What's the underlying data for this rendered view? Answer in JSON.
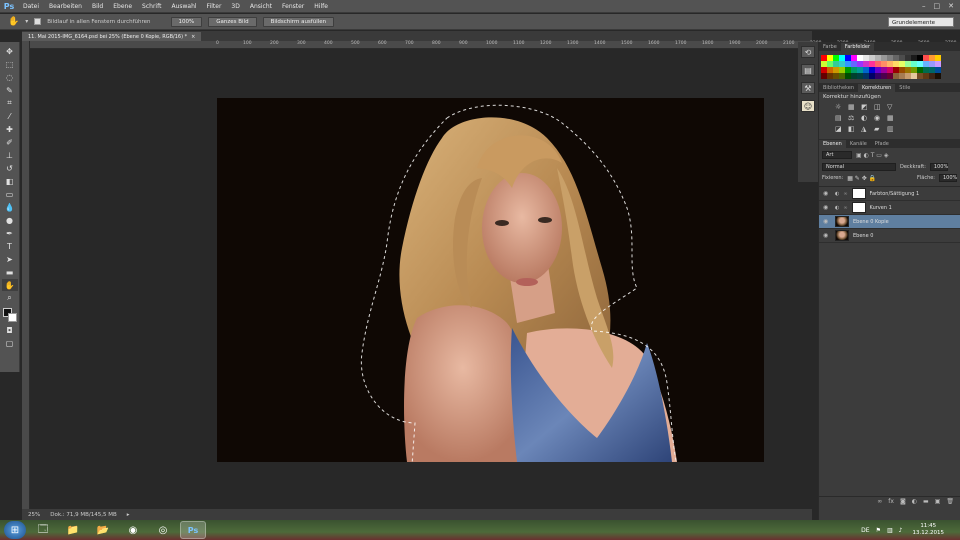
{
  "app": {
    "logo": "Ps"
  },
  "menu": [
    "Datei",
    "Bearbeiten",
    "Bild",
    "Ebene",
    "Schrift",
    "Auswahl",
    "Filter",
    "3D",
    "Ansicht",
    "Fenster",
    "Hilfe"
  ],
  "window_controls": [
    "–",
    "□",
    "✕"
  ],
  "options": {
    "checkbox_label": "Bildlauf in allen Fenstern durchführen",
    "btn1": "100%",
    "btn2": "Ganzes Bild",
    "btn3": "Bildschirm ausfüllen",
    "workspace": "Grundelemente"
  },
  "document_tab": {
    "title": "11. Mai 2015-IMG_6164.psd bei 25% (Ebene 0 Kopie, RGB/16) *",
    "close": "×"
  },
  "ruler_ticks": [
    "0",
    "100",
    "200",
    "300",
    "400",
    "500",
    "600",
    "700",
    "800",
    "900",
    "1000",
    "1100",
    "1200",
    "1300",
    "1400",
    "1500",
    "1600",
    "1700",
    "1800",
    "1900",
    "2000",
    "2100",
    "2200",
    "2300",
    "2400",
    "2500",
    "2600",
    "2700",
    "2800"
  ],
  "status": {
    "zoom": "25%",
    "doc": "Dok.: 71,9 MB/145,5 MB"
  },
  "panels": {
    "top_tabs": [
      "Farbe",
      "Farbfelder"
    ],
    "swatch_colors": [
      "#ff0000",
      "#ffff00",
      "#00ff00",
      "#00ffff",
      "#0000ff",
      "#ff00ff",
      "#ffffff",
      "#e6e6e6",
      "#cccccc",
      "#b3b3b3",
      "#999999",
      "#808080",
      "#666666",
      "#4d4d4d",
      "#333333",
      "#1a1a1a",
      "#000000",
      "#ff4d4d",
      "#ff9933",
      "#ffcc00",
      "#ccff33",
      "#66ff66",
      "#33cc99",
      "#33cccc",
      "#3399ff",
      "#6666ff",
      "#9933ff",
      "#cc33cc",
      "#ff3399",
      "#ff6666",
      "#ff8c66",
      "#ffb366",
      "#ffd966",
      "#e6ff66",
      "#99ff99",
      "#66ffcc",
      "#66ffff",
      "#66b3ff",
      "#9999ff",
      "#cc99ff",
      "#cc0000",
      "#cc6600",
      "#cc9900",
      "#99cc00",
      "#009900",
      "#009966",
      "#009999",
      "#0066cc",
      "#0000cc",
      "#6600cc",
      "#990099",
      "#cc0066",
      "#990000",
      "#994c00",
      "#997300",
      "#739900",
      "#006600",
      "#006b4d",
      "#006666",
      "#004c99",
      "#660000",
      "#663300",
      "#664d00",
      "#4d6600",
      "#004d00",
      "#00402e",
      "#004040",
      "#003366",
      "#000066",
      "#330066",
      "#4d004d",
      "#660033",
      "#8c6239",
      "#a67c52",
      "#c69c6d",
      "#e6c89c",
      "#754c24",
      "#603913",
      "#3c2415",
      "#1a0f05"
    ],
    "adj_tabs": [
      "Bibliotheken",
      "Korrekturen",
      "Stile"
    ],
    "adj_title": "Korrektur hinzufügen",
    "adj_icons_row1": [
      "☼",
      "▦",
      "◩",
      "◫",
      "▽"
    ],
    "adj_icons_row2": [
      "▤",
      "⚖",
      "◐",
      "◉",
      "▦"
    ],
    "adj_icons_row3": [
      "◪",
      "◧",
      "◮",
      "▰",
      "▥"
    ],
    "layer_tabs": [
      "Ebenen",
      "Kanäle",
      "Pfade"
    ],
    "filter_kind": "Art",
    "blend_mode": "Normal",
    "opacity_label": "Deckkraft:",
    "opacity_value": "100%",
    "lock_label": "Fixieren:",
    "fill_label": "Fläche:",
    "fill_value": "100%",
    "layers": [
      {
        "name": "Farbton/Sättigung 1",
        "type": "adjustment",
        "selected": false
      },
      {
        "name": "Kurven 1",
        "type": "adjustment",
        "selected": false
      },
      {
        "name": "Ebene 0 Kopie",
        "type": "image",
        "selected": true
      },
      {
        "name": "Ebene 0",
        "type": "image",
        "selected": false
      }
    ]
  },
  "taskbar": {
    "time": "11:45",
    "date": "13.12.2015",
    "tray_label": "DE"
  }
}
